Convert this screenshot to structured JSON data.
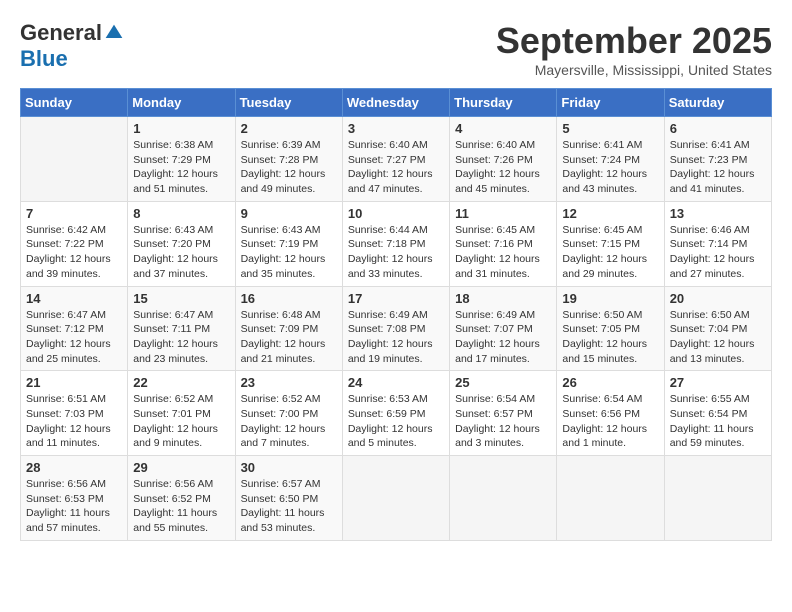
{
  "header": {
    "logo_general": "General",
    "logo_blue": "Blue",
    "month_title": "September 2025",
    "location": "Mayersville, Mississippi, United States"
  },
  "weekdays": [
    "Sunday",
    "Monday",
    "Tuesday",
    "Wednesday",
    "Thursday",
    "Friday",
    "Saturday"
  ],
  "weeks": [
    [
      {
        "day": "",
        "info": ""
      },
      {
        "day": "1",
        "info": "Sunrise: 6:38 AM\nSunset: 7:29 PM\nDaylight: 12 hours\nand 51 minutes."
      },
      {
        "day": "2",
        "info": "Sunrise: 6:39 AM\nSunset: 7:28 PM\nDaylight: 12 hours\nand 49 minutes."
      },
      {
        "day": "3",
        "info": "Sunrise: 6:40 AM\nSunset: 7:27 PM\nDaylight: 12 hours\nand 47 minutes."
      },
      {
        "day": "4",
        "info": "Sunrise: 6:40 AM\nSunset: 7:26 PM\nDaylight: 12 hours\nand 45 minutes."
      },
      {
        "day": "5",
        "info": "Sunrise: 6:41 AM\nSunset: 7:24 PM\nDaylight: 12 hours\nand 43 minutes."
      },
      {
        "day": "6",
        "info": "Sunrise: 6:41 AM\nSunset: 7:23 PM\nDaylight: 12 hours\nand 41 minutes."
      }
    ],
    [
      {
        "day": "7",
        "info": "Sunrise: 6:42 AM\nSunset: 7:22 PM\nDaylight: 12 hours\nand 39 minutes."
      },
      {
        "day": "8",
        "info": "Sunrise: 6:43 AM\nSunset: 7:20 PM\nDaylight: 12 hours\nand 37 minutes."
      },
      {
        "day": "9",
        "info": "Sunrise: 6:43 AM\nSunset: 7:19 PM\nDaylight: 12 hours\nand 35 minutes."
      },
      {
        "day": "10",
        "info": "Sunrise: 6:44 AM\nSunset: 7:18 PM\nDaylight: 12 hours\nand 33 minutes."
      },
      {
        "day": "11",
        "info": "Sunrise: 6:45 AM\nSunset: 7:16 PM\nDaylight: 12 hours\nand 31 minutes."
      },
      {
        "day": "12",
        "info": "Sunrise: 6:45 AM\nSunset: 7:15 PM\nDaylight: 12 hours\nand 29 minutes."
      },
      {
        "day": "13",
        "info": "Sunrise: 6:46 AM\nSunset: 7:14 PM\nDaylight: 12 hours\nand 27 minutes."
      }
    ],
    [
      {
        "day": "14",
        "info": "Sunrise: 6:47 AM\nSunset: 7:12 PM\nDaylight: 12 hours\nand 25 minutes."
      },
      {
        "day": "15",
        "info": "Sunrise: 6:47 AM\nSunset: 7:11 PM\nDaylight: 12 hours\nand 23 minutes."
      },
      {
        "day": "16",
        "info": "Sunrise: 6:48 AM\nSunset: 7:09 PM\nDaylight: 12 hours\nand 21 minutes."
      },
      {
        "day": "17",
        "info": "Sunrise: 6:49 AM\nSunset: 7:08 PM\nDaylight: 12 hours\nand 19 minutes."
      },
      {
        "day": "18",
        "info": "Sunrise: 6:49 AM\nSunset: 7:07 PM\nDaylight: 12 hours\nand 17 minutes."
      },
      {
        "day": "19",
        "info": "Sunrise: 6:50 AM\nSunset: 7:05 PM\nDaylight: 12 hours\nand 15 minutes."
      },
      {
        "day": "20",
        "info": "Sunrise: 6:50 AM\nSunset: 7:04 PM\nDaylight: 12 hours\nand 13 minutes."
      }
    ],
    [
      {
        "day": "21",
        "info": "Sunrise: 6:51 AM\nSunset: 7:03 PM\nDaylight: 12 hours\nand 11 minutes."
      },
      {
        "day": "22",
        "info": "Sunrise: 6:52 AM\nSunset: 7:01 PM\nDaylight: 12 hours\nand 9 minutes."
      },
      {
        "day": "23",
        "info": "Sunrise: 6:52 AM\nSunset: 7:00 PM\nDaylight: 12 hours\nand 7 minutes."
      },
      {
        "day": "24",
        "info": "Sunrise: 6:53 AM\nSunset: 6:59 PM\nDaylight: 12 hours\nand 5 minutes."
      },
      {
        "day": "25",
        "info": "Sunrise: 6:54 AM\nSunset: 6:57 PM\nDaylight: 12 hours\nand 3 minutes."
      },
      {
        "day": "26",
        "info": "Sunrise: 6:54 AM\nSunset: 6:56 PM\nDaylight: 12 hours\nand 1 minute."
      },
      {
        "day": "27",
        "info": "Sunrise: 6:55 AM\nSunset: 6:54 PM\nDaylight: 11 hours\nand 59 minutes."
      }
    ],
    [
      {
        "day": "28",
        "info": "Sunrise: 6:56 AM\nSunset: 6:53 PM\nDaylight: 11 hours\nand 57 minutes."
      },
      {
        "day": "29",
        "info": "Sunrise: 6:56 AM\nSunset: 6:52 PM\nDaylight: 11 hours\nand 55 minutes."
      },
      {
        "day": "30",
        "info": "Sunrise: 6:57 AM\nSunset: 6:50 PM\nDaylight: 11 hours\nand 53 minutes."
      },
      {
        "day": "",
        "info": ""
      },
      {
        "day": "",
        "info": ""
      },
      {
        "day": "",
        "info": ""
      },
      {
        "day": "",
        "info": ""
      }
    ]
  ]
}
